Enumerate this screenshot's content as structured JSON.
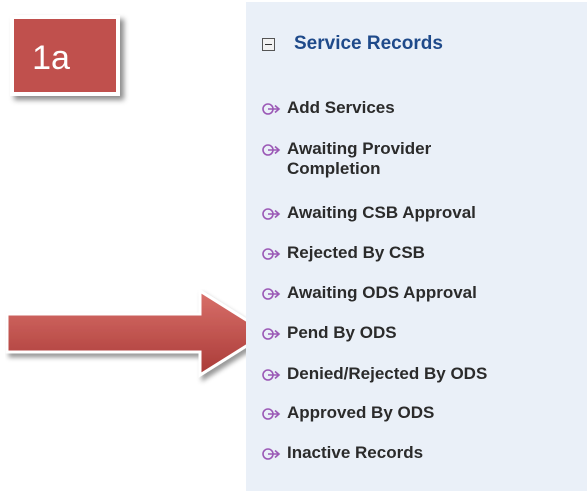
{
  "step": {
    "label": "1a"
  },
  "panel": {
    "title": "Service Records",
    "icons": {
      "section": "collapse-minus-icon",
      "item": "arrow-circle-right-icon"
    },
    "colors": {
      "title": "#1f4a8a",
      "item_icon": "#9b59b6",
      "step_box": "#c0504d",
      "arrow": "#b8413e"
    },
    "items": [
      {
        "label": "Add Services"
      },
      {
        "label": "Awaiting Provider Completion"
      },
      {
        "label": "Awaiting CSB Approval"
      },
      {
        "label": "Rejected By CSB"
      },
      {
        "label": "Awaiting ODS Approval"
      },
      {
        "label": "Pend By ODS"
      },
      {
        "label": "Denied/Rejected By ODS"
      },
      {
        "label": "Approved By ODS"
      },
      {
        "label": "Inactive Records"
      }
    ]
  }
}
